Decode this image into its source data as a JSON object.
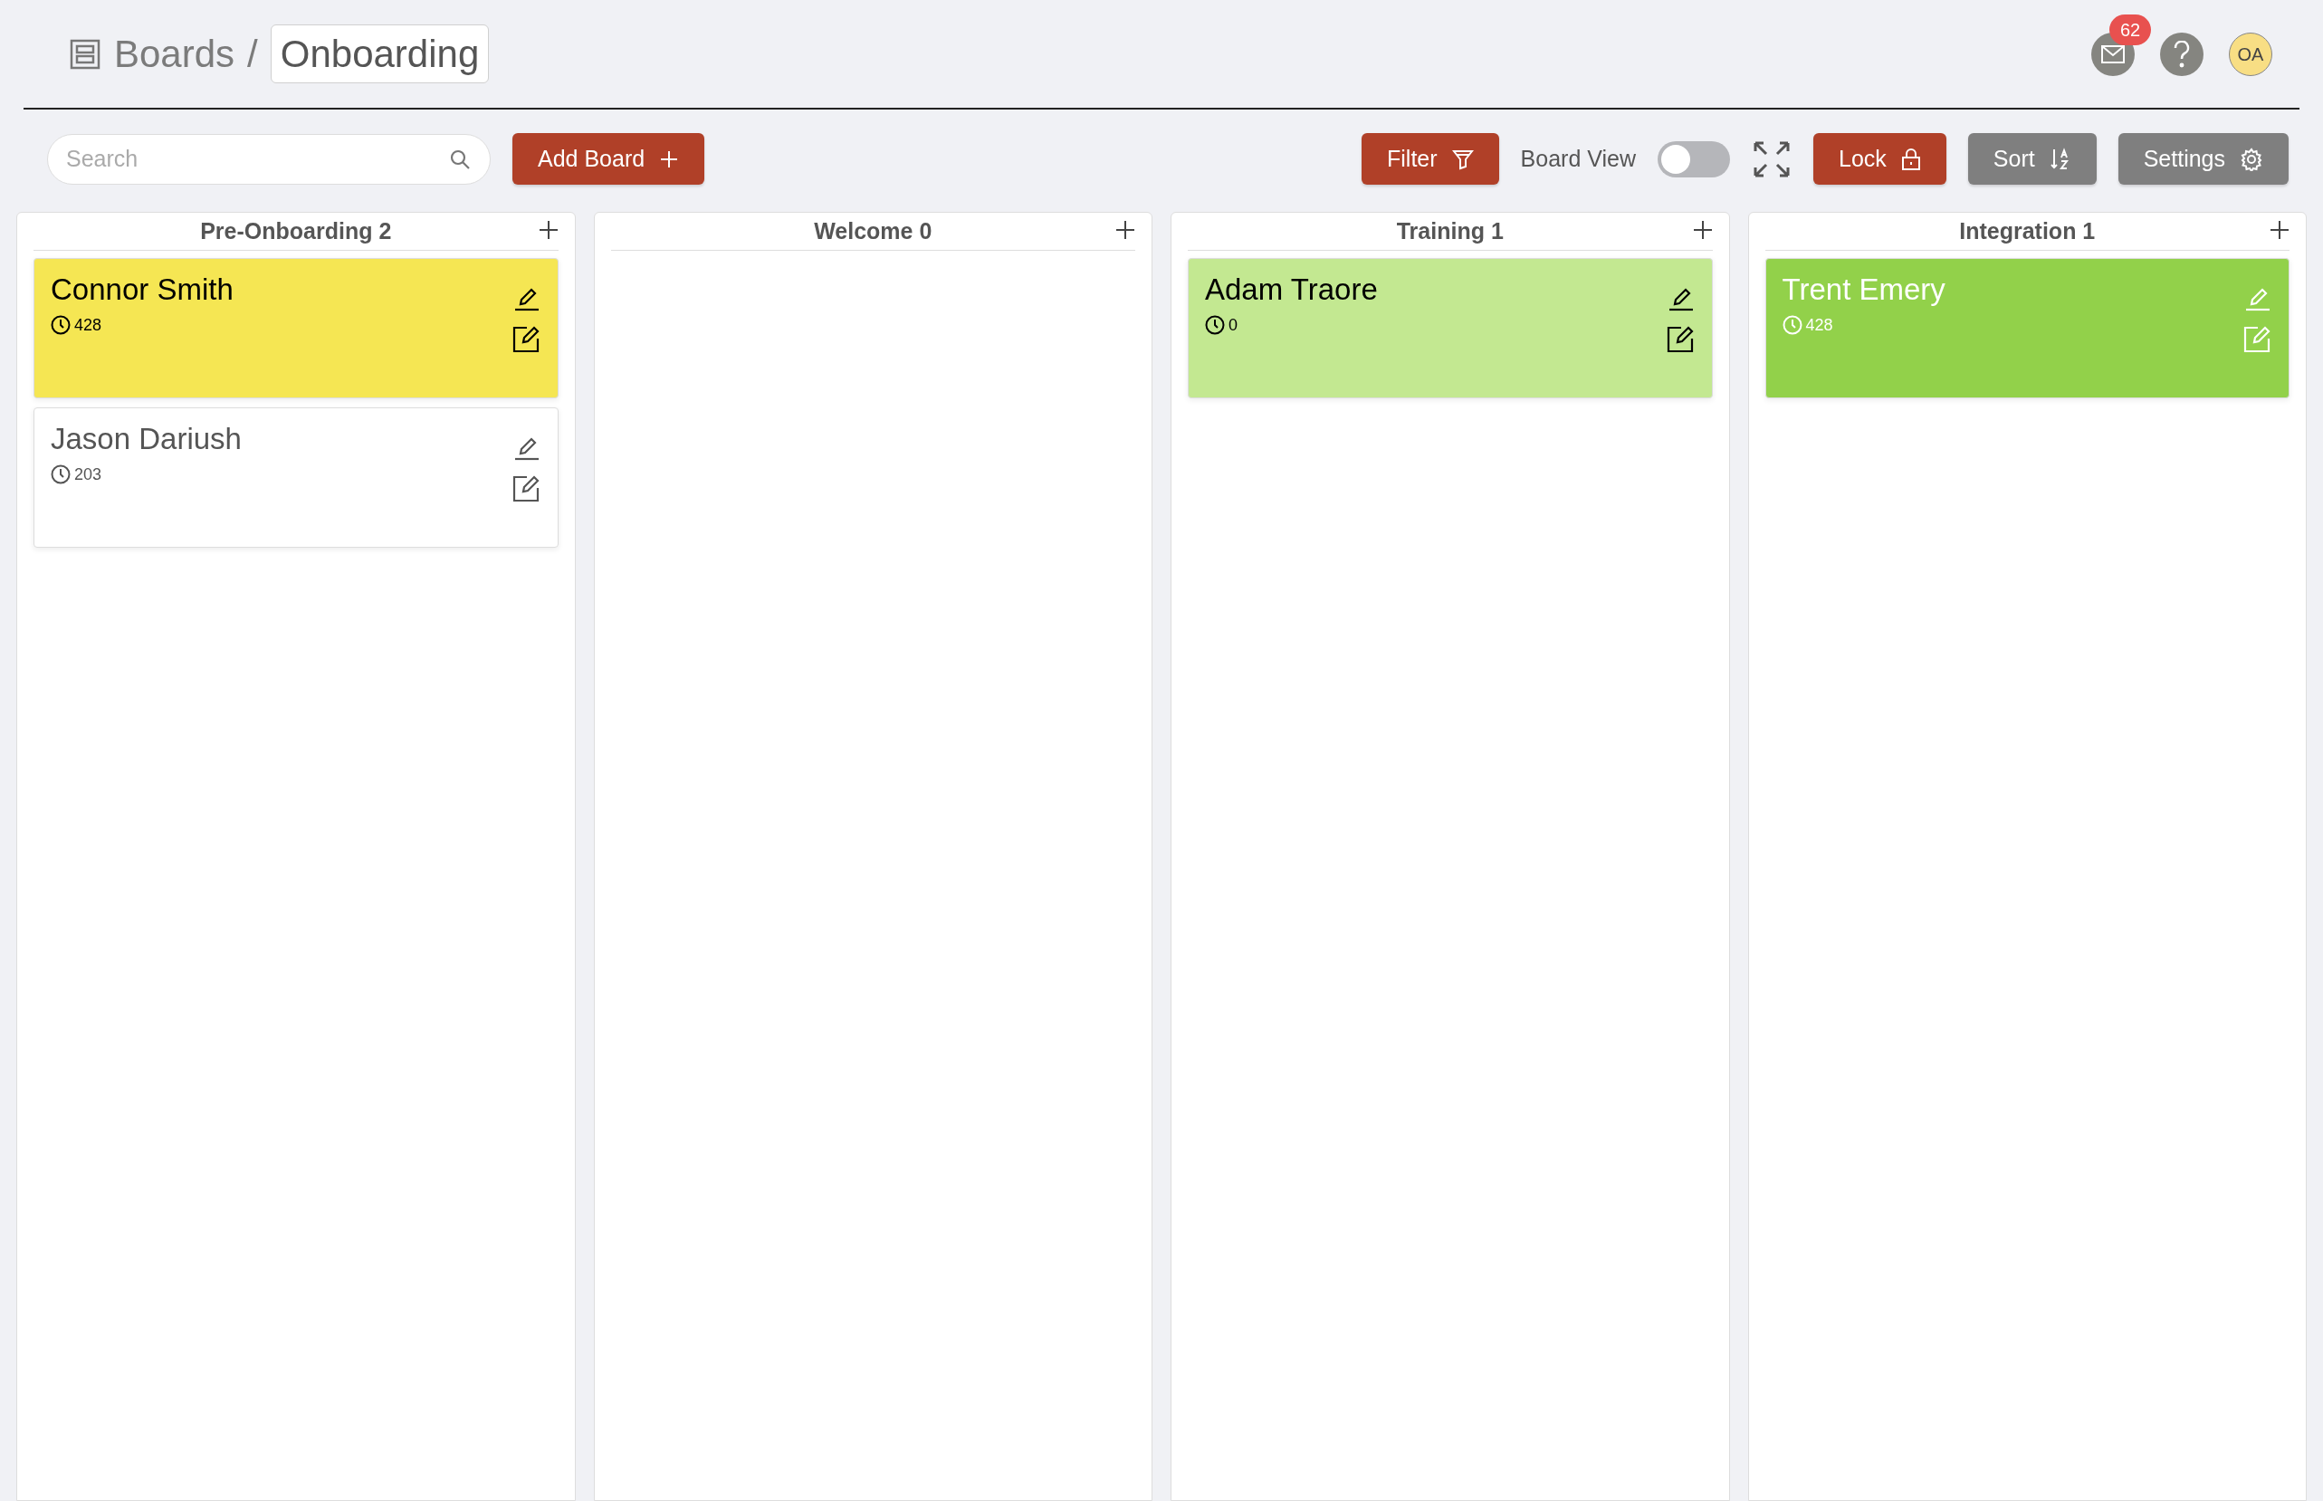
{
  "breadcrumb": {
    "root": "Boards",
    "separator": "/",
    "current": "Onboarding"
  },
  "header": {
    "mail_badge": "62",
    "avatar": "OA"
  },
  "toolbar": {
    "search": {
      "placeholder": "Search"
    },
    "add_board": "Add Board",
    "filter": "Filter",
    "board_view": {
      "label": "Board View",
      "on": false
    },
    "lock": "Lock",
    "sort": "Sort",
    "settings": "Settings"
  },
  "columns": [
    {
      "title": "Pre-Onboarding",
      "count": "2",
      "cards": [
        {
          "name": "Connor Smith",
          "time": "428",
          "color": "#f5e653"
        },
        {
          "name": "Jason Dariush",
          "time": "203",
          "color": "#ffffff"
        }
      ]
    },
    {
      "title": "Welcome",
      "count": "0"
    },
    {
      "title": "Training",
      "count": "1",
      "cards": [
        {
          "name": "Adam Traore",
          "time": "0",
          "color": "#c3e891"
        }
      ]
    },
    {
      "title": "Integration",
      "count": "1",
      "cards": [
        {
          "name": "Trent Emery",
          "time": "428",
          "color": "#92d14a"
        }
      ]
    }
  ]
}
